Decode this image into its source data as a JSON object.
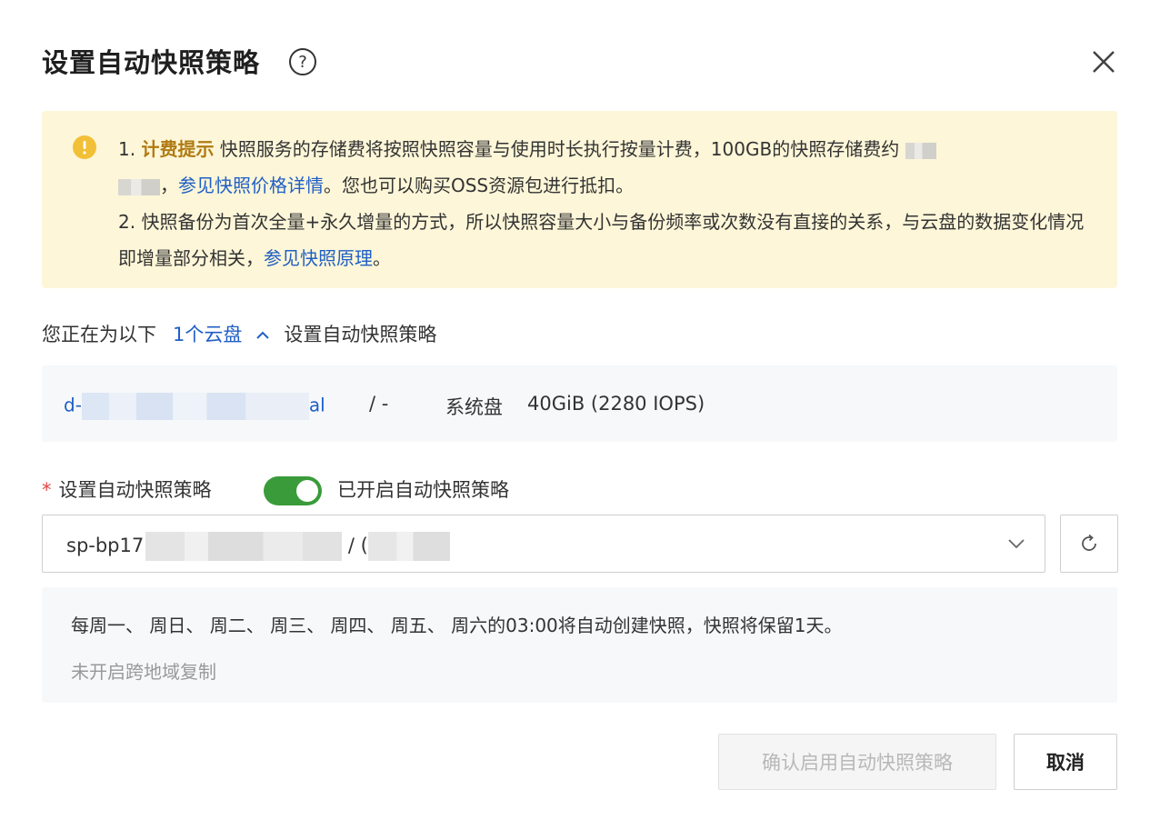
{
  "dialog": {
    "title": "设置自动快照策略"
  },
  "notice": {
    "line1_prefix": "1. ",
    "billing_title": "计费提示",
    "line1_text": " 快照服务的存储费将按照快照容量与使用时长执行按量计费，100GB的快照存储费约",
    "line2_comma": "，",
    "price_link": "参见快照价格详情",
    "line2_text": "。您也可以购买OSS资源包进行抵扣。",
    "line3_text": "2. 快照备份为首次全量+永久增量的方式，所以快照容量大小与备份频率或次数没有直接的关系，与云盘的数据变化情况即增量部分相关，",
    "principle_link": "参见快照原理",
    "line3_end": "。"
  },
  "target": {
    "prefix": "您正在为以下",
    "disks_link": "1个云盘",
    "suffix": "设置自动快照策略"
  },
  "disk": {
    "id_start": "d-",
    "id_end": "al",
    "separator": "/  -",
    "type": "系统盘",
    "size": "40GiB (2280 IOPS)"
  },
  "policy_field": {
    "required_mark": "*",
    "label": "设置自动快照策略",
    "toggle_on": true,
    "toggle_label": "已开启自动快照策略",
    "select_value_prefix": "sp-bp17",
    "select_value_sep": " / ("
  },
  "policy_details": {
    "schedule": "每周一、 周日、 周二、 周三、 周四、 周五、 周六的03:00将自动创建快照，快照将保留1天。",
    "cross_region": "未开启跨地域复制"
  },
  "footer": {
    "confirm_label": "确认启用自动快照策略",
    "cancel_label": "取消"
  },
  "colors": {
    "link": "#1f5fc6",
    "toggle_on": "#3a9b3a",
    "notice_bg": "#fdf6d8",
    "warning": "#f2c037"
  }
}
